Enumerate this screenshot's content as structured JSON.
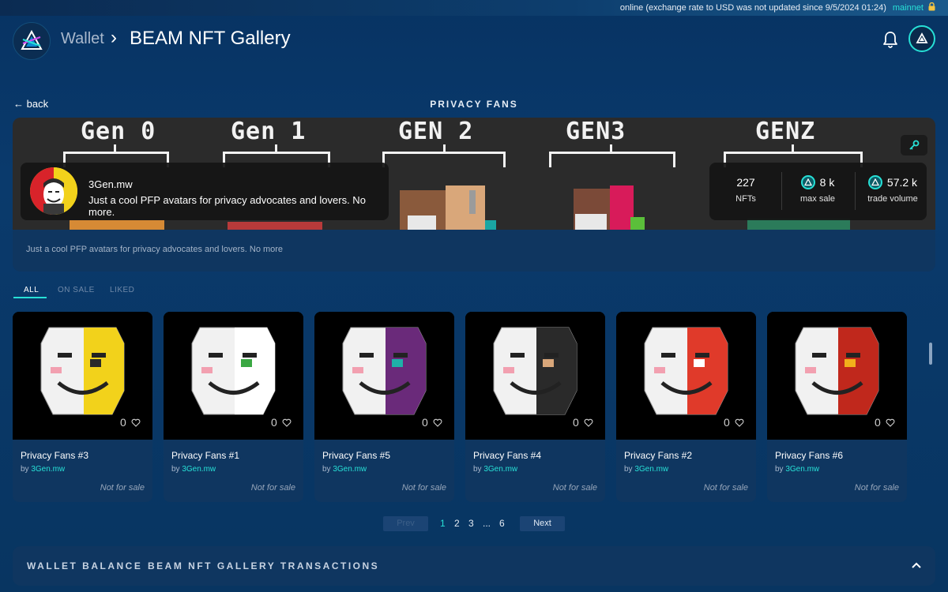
{
  "status": {
    "text": "online (exchange rate to USD was not updated since 9/5/2024  01:24)",
    "network": "mainnet"
  },
  "header": {
    "breadcrumb_parent": "Wallet",
    "separator": "›",
    "title": "BEAM NFT Gallery"
  },
  "subheader": {
    "back_label": "← back",
    "section_title": "PRIVACY FANS"
  },
  "banner": {
    "gens": [
      "Gen 0",
      "Gen 1",
      "GEN 2",
      "GEN3",
      "GENZ"
    ],
    "creator_name": "3Gen.mw",
    "creator_description": "Just a cool PFP avatars for privacy advocates and lovers. No more.",
    "stats": [
      {
        "value": "227",
        "label": "NFTs"
      },
      {
        "value": "8 k",
        "label": "max sale"
      },
      {
        "value": "57.2 k",
        "label": "trade volume"
      }
    ],
    "description": "Just a cool PFP avatars for privacy advocates and lovers. No more"
  },
  "tabs": [
    "ALL",
    "ON SALE",
    "LIKED"
  ],
  "cards": [
    {
      "name": "Privacy Fans #3",
      "by": "by",
      "author": "3Gen.mw",
      "likes": "0",
      "price": "Not for sale"
    },
    {
      "name": "Privacy Fans #1",
      "by": "by",
      "author": "3Gen.mw",
      "likes": "0",
      "price": "Not for sale"
    },
    {
      "name": "Privacy Fans #5",
      "by": "by",
      "author": "3Gen.mw",
      "likes": "0",
      "price": "Not for sale"
    },
    {
      "name": "Privacy Fans #4",
      "by": "by",
      "author": "3Gen.mw",
      "likes": "0",
      "price": "Not for sale"
    },
    {
      "name": "Privacy Fans #2",
      "by": "by",
      "author": "3Gen.mw",
      "likes": "0",
      "price": "Not for sale"
    },
    {
      "name": "Privacy Fans #6",
      "by": "by",
      "author": "3Gen.mw",
      "likes": "0",
      "price": "Not for sale"
    }
  ],
  "pagination": {
    "prev": "Prev",
    "pages": [
      "1",
      "2",
      "3",
      "...",
      "6"
    ],
    "next": "Next"
  },
  "bottom_bar": {
    "tab1": "WALLET BALANCE",
    "tab2": "BEAM NFT GALLERY TRANSACTIONS"
  },
  "colors": {
    "accent": "#27e0d6",
    "background": "#073363",
    "card": "#0f3660"
  }
}
